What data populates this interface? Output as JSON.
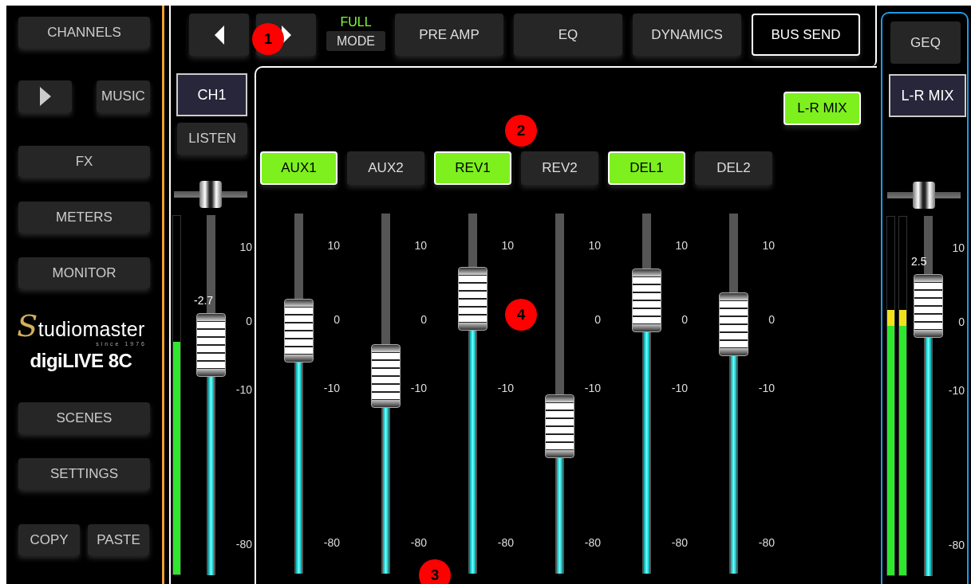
{
  "sidebar": {
    "buttons": [
      {
        "label": "CHANNELS",
        "kind": "wide"
      },
      {
        "label": "MUSIC",
        "kind": "play"
      },
      {
        "label": "FX",
        "kind": "wide"
      },
      {
        "label": "METERS",
        "kind": "wide"
      },
      {
        "label": "MONITOR",
        "kind": "wide"
      },
      {
        "label": "SCENES",
        "kind": "wide"
      },
      {
        "label": "SETTINGS",
        "kind": "wide"
      },
      {
        "label": "COPY",
        "kind": "half"
      },
      {
        "label": "PASTE",
        "kind": "half"
      }
    ],
    "logo": {
      "brand": "Studiomaster",
      "tagline": "since 1976",
      "product": "digiLIVE 8C"
    }
  },
  "topbar": {
    "mode_label": "FULL",
    "mode_button": "MODE",
    "tabs": [
      {
        "label": "PRE AMP",
        "selected": false
      },
      {
        "label": "EQ",
        "selected": false
      },
      {
        "label": "DYNAMICS",
        "selected": false
      },
      {
        "label": "BUS SEND",
        "selected": true
      }
    ]
  },
  "channel": {
    "name": "CH1",
    "listen": "LISTEN",
    "pan": {
      "level": 0.5
    },
    "meter": {
      "level": 0.65
    },
    "level": 0.64,
    "value": "-2.7",
    "scale": [
      "10",
      "0",
      "-10",
      "-80"
    ]
  },
  "mix_button": {
    "label": "L-R MIX",
    "selected": true
  },
  "sends": [
    {
      "name": "AUX1",
      "selected": true,
      "level": 0.675,
      "scale": [
        "10",
        "0",
        "-10",
        "-80"
      ]
    },
    {
      "name": "AUX2",
      "selected": false,
      "level": 0.549,
      "scale": [
        "10",
        "0",
        "-10",
        "-80"
      ]
    },
    {
      "name": "REV1",
      "selected": true,
      "level": 0.763,
      "scale": [
        {
          "label": "10",
          "kind": "top"
        },
        {
          "label": "-10",
          "kind": "low"
        },
        {
          "label": "-80",
          "kind": "bottom"
        }
      ]
    },
    {
      "name": "REV2",
      "selected": false,
      "level": 0.409,
      "scale": [
        "10",
        "0",
        "-10",
        "-80"
      ]
    },
    {
      "name": "DEL1",
      "selected": true,
      "level": 0.759,
      "scale": [
        "10",
        "0",
        "-10",
        "-80"
      ]
    },
    {
      "name": "DEL2",
      "selected": false,
      "level": 0.692,
      "scale": [
        "10",
        "0",
        "-10",
        "-80"
      ]
    }
  ],
  "master": {
    "geq": "GEQ",
    "name": "L-R MIX",
    "pan": {
      "level": 0.5
    },
    "meters": [
      {
        "level": 0.74
      },
      {
        "level": 0.74
      }
    ],
    "level": 0.75,
    "value": "2.5",
    "scale": [
      "10",
      "0",
      "-10",
      "-80"
    ]
  },
  "callouts": [
    "1",
    "2",
    "3",
    "4"
  ]
}
